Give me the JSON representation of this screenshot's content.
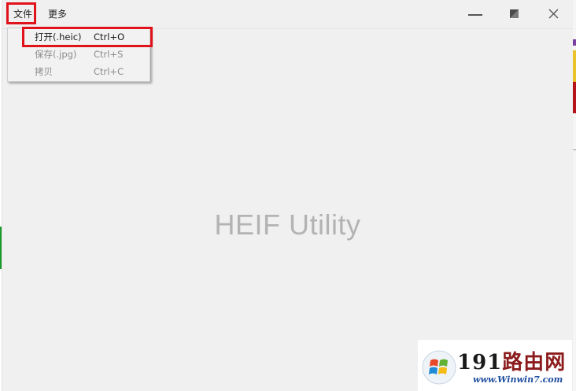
{
  "menubar": {
    "file_label": "文件",
    "more_label": "更多"
  },
  "window_controls": {
    "minimize_icon": "minimize-icon",
    "restore_icon": "restore-icon",
    "close_icon": "close-icon"
  },
  "file_menu": {
    "items": [
      {
        "label": "打开(.heic)",
        "shortcut": "Ctrl+O",
        "enabled": true
      },
      {
        "label": "保存(.jpg)",
        "shortcut": "Ctrl+S",
        "enabled": false
      },
      {
        "label": "拷贝",
        "shortcut": "Ctrl+C",
        "enabled": false
      }
    ]
  },
  "splash": {
    "app_name": "HEIF Utility"
  },
  "watermark": {
    "logo_icon": "windows-logo-icon",
    "brand_num": "191",
    "brand_cn": "路由网",
    "url": "www.Winwin7.com"
  },
  "colors": {
    "highlight_red": "#e0121a",
    "window_bg": "#f0f0f0",
    "splash_text": "#b3b3b3"
  }
}
